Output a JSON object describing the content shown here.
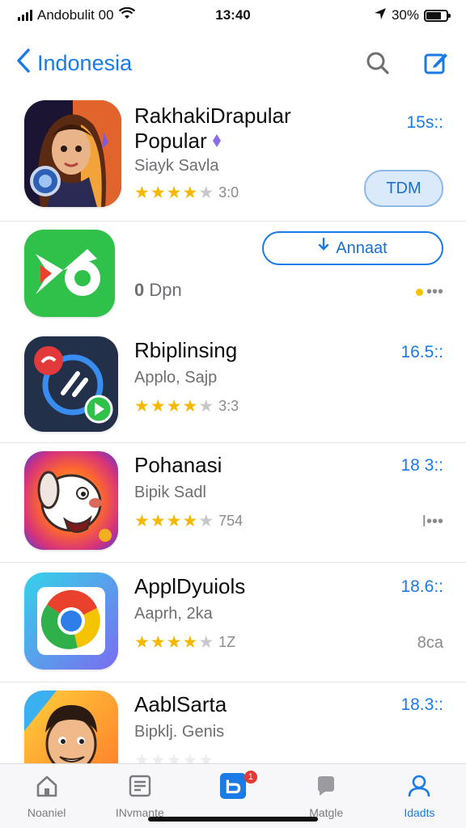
{
  "status_bar": {
    "carrier": "Andobulit 00",
    "time": "13:40",
    "battery": "30%"
  },
  "nav": {
    "back_label": "Indonesia",
    "icons": [
      "chevron-left-icon",
      "search-icon",
      "compose-icon"
    ]
  },
  "apps": [
    {
      "name_line1": "RakhakiDrapular",
      "name_line2": "Popular",
      "subtitle": "Siayk Savla",
      "stars": 4,
      "rating_text": "3:0",
      "price": "15s::",
      "action_label": "TDM",
      "icon": "woman-avatar-icon"
    },
    {
      "subtitle": "Dpn",
      "subtitle_prefix": "0",
      "action_label": "Annaat",
      "action_icon": "download-icon",
      "more_text": "•••",
      "icon": "green-play-icon"
    },
    {
      "name": "Rbiplinsing",
      "subtitle": "Applo, Sajp",
      "stars": 4,
      "rating_text": "3:3",
      "price": "16.5::",
      "icon": "blue-dial-icon"
    },
    {
      "name": "Pohanasi",
      "subtitle": "Bipik Sadl",
      "stars": 4,
      "rating_text": "754",
      "price": "18 3::",
      "more_text": "I•••",
      "icon": "cartoon-dog-icon"
    },
    {
      "name": "ApplDyuiols",
      "subtitle": "Aaprh, 2ka",
      "stars": 4,
      "rating_text": "1Z",
      "price": "18.6::",
      "more_text": "8ca",
      "icon": "chrome-like-icon"
    },
    {
      "name": "AablSarta",
      "subtitle": "Bipklj. Genis",
      "price": "18.3::",
      "icon": "cartoon-man-icon"
    }
  ],
  "tabs": [
    {
      "label": "Noaniel",
      "icon": "home-icon"
    },
    {
      "label": "INvmante",
      "icon": "list-icon"
    },
    {
      "label": "",
      "icon": "apps-store-icon",
      "badge": "1"
    },
    {
      "label": "Matgle",
      "icon": "chat-icon"
    },
    {
      "label": "Idadts",
      "icon": "person-icon"
    }
  ],
  "colors": {
    "accent": "#1a7ae6",
    "star": "#f5b800",
    "separator": "#e4e6ea"
  }
}
